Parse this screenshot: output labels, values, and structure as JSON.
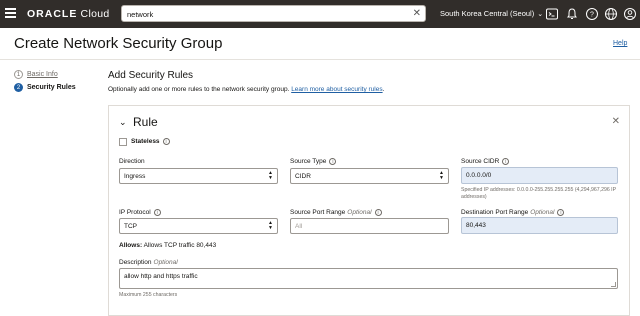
{
  "topbar": {
    "logo_brand": "ORACLE",
    "logo_product": " Cloud",
    "search_value": "network",
    "region": "South Korea Central (Seoul)",
    "icons": [
      "hamburger-icon",
      "cloud-shell-icon",
      "bell-icon",
      "help-icon",
      "globe-icon",
      "profile-icon"
    ]
  },
  "page": {
    "title": "Create Network Security Group",
    "help": "Help"
  },
  "steps": [
    {
      "number": "1",
      "label": "Basic Info"
    },
    {
      "number": "2",
      "label": "Security Rules"
    }
  ],
  "section": {
    "title": "Add Security Rules",
    "description": "Optionally add one or more rules to the network security group.",
    "link": "Learn more about security rules",
    "link_suffix": "."
  },
  "rule": {
    "title": "Rule",
    "stateless_label": "Stateless",
    "direction_label": "Direction",
    "direction_value": "Ingress",
    "source_type_label": "Source Type",
    "source_type_value": "CIDR",
    "source_cidr_label": "Source CIDR",
    "source_cidr_value": "0.0.0.0/0",
    "source_cidr_hint": "Specified IP addresses: 0.0.0.0-255.255.255.255 (4,294,967,296 IP addresses)",
    "ip_protocol_label": "IP Protocol",
    "ip_protocol_value": "TCP",
    "source_port_label": "Source Port Range",
    "source_port_optional": "Optional",
    "source_port_placeholder": "All",
    "dest_port_label": "Destination Port Range",
    "dest_port_optional": "Optional",
    "dest_port_value": "80,443",
    "allows_label": "Allows:",
    "allows_text": "Allows TCP traffic 80,443",
    "description_label": "Description",
    "description_optional": "Optional",
    "description_value": "allow http and https traffic",
    "description_hint": "Maximum 255 characters"
  },
  "colors": {
    "topbar": "#312d2a",
    "link": "#1f5fa3",
    "highlight_field": "#e4ecf7"
  }
}
